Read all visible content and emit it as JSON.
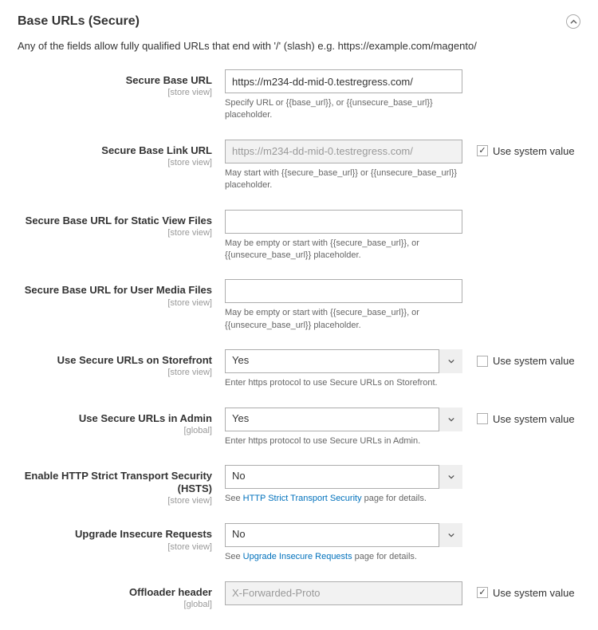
{
  "section_title": "Base URLs (Secure)",
  "note": "Any of the fields allow fully qualified URLs that end with '/' (slash) e.g. https://example.com/magento/",
  "use_system_value_label": "Use system value",
  "rows": [
    {
      "label": "Secure Base URL",
      "scope": "[store view]",
      "type": "text",
      "value": "https://m234-dd-mid-0.testregress.com/",
      "disabled": false,
      "hint": "Specify URL or {{base_url}}, or {{unsecure_base_url}} placeholder.",
      "show_usv": false,
      "usv_checked": false
    },
    {
      "label": "Secure Base Link URL",
      "scope": "[store view]",
      "type": "text",
      "value": "https://m234-dd-mid-0.testregress.com/",
      "disabled": true,
      "hint": "May start with {{secure_base_url}} or {{unsecure_base_url}} placeholder.",
      "show_usv": true,
      "usv_checked": true
    },
    {
      "label": "Secure Base URL for Static View Files",
      "scope": "[store view]",
      "type": "text",
      "value": "",
      "disabled": false,
      "hint": "May be empty or start with {{secure_base_url}}, or {{unsecure_base_url}} placeholder.",
      "show_usv": false,
      "usv_checked": false
    },
    {
      "label": "Secure Base URL for User Media Files",
      "scope": "[store view]",
      "type": "text",
      "value": "",
      "disabled": false,
      "hint": "May be empty or start with {{secure_base_url}}, or {{unsecure_base_url}} placeholder.",
      "show_usv": false,
      "usv_checked": false
    },
    {
      "label": "Use Secure URLs on Storefront",
      "scope": "[store view]",
      "type": "select",
      "value": "Yes",
      "disabled": false,
      "hint": "Enter https protocol to use Secure URLs on Storefront.",
      "show_usv": true,
      "usv_checked": false
    },
    {
      "label": "Use Secure URLs in Admin",
      "scope": "[global]",
      "type": "select",
      "value": "Yes",
      "disabled": false,
      "hint": "Enter https protocol to use Secure URLs in Admin.",
      "show_usv": true,
      "usv_checked": false
    },
    {
      "label": "Enable HTTP Strict Transport Security (HSTS)",
      "scope": "[store view]",
      "type": "select",
      "value": "No",
      "disabled": false,
      "hint_prefix": "See ",
      "hint_link": "HTTP Strict Transport Security",
      "hint_suffix": " page for details.",
      "show_usv": false,
      "usv_checked": false
    },
    {
      "label": "Upgrade Insecure Requests",
      "scope": "[store view]",
      "type": "select",
      "value": "No",
      "disabled": false,
      "hint_prefix": "See ",
      "hint_link": "Upgrade Insecure Requests",
      "hint_suffix": " page for details.",
      "show_usv": false,
      "usv_checked": false
    },
    {
      "label": "Offloader header",
      "scope": "[global]",
      "type": "text",
      "value": "",
      "placeholder": "X-Forwarded-Proto",
      "disabled": true,
      "hint": "",
      "show_usv": true,
      "usv_checked": true
    }
  ]
}
